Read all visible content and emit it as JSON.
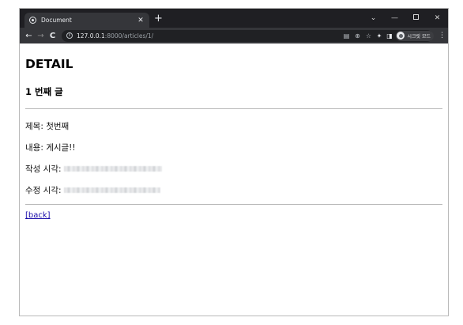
{
  "browser": {
    "tab": {
      "title": "Document",
      "favicon": "globe-icon"
    },
    "new_tab": "+",
    "window_controls": {
      "minimize": "—",
      "close": "✕",
      "tab_search": "⌄"
    },
    "nav": {
      "back": "←",
      "forward": "→",
      "reload": "C"
    },
    "address": {
      "host": "127.0.0.1",
      "path": ":8000/articles/1/"
    },
    "profile": {
      "label": "시크릿 모드"
    }
  },
  "page": {
    "title": "DETAIL",
    "article_heading": "1 번째 글",
    "fields": {
      "title_label": "제목:",
      "title_value": "첫번째",
      "content_label": "내용:",
      "content_value": "게시글!!",
      "created_label": "작성 시각:",
      "updated_label": "수정 시각:"
    },
    "back_link": "[back]"
  },
  "colors": {
    "tabstrip": "#1f1f23",
    "toolbar": "#35363a",
    "omnibox": "#202124",
    "link": "#1a0dab",
    "rule": "#b9b9b9"
  }
}
